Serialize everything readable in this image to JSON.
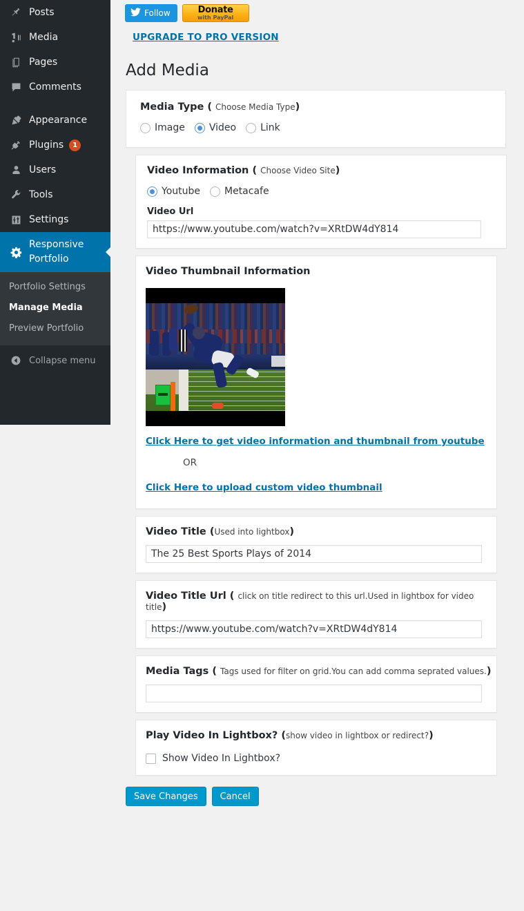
{
  "sidebar": {
    "items": [
      {
        "label": "Posts",
        "icon": "pin-icon",
        "badge": null
      },
      {
        "label": "Media",
        "icon": "media-icon",
        "badge": null
      },
      {
        "label": "Pages",
        "icon": "pages-icon",
        "badge": null
      },
      {
        "label": "Comments",
        "icon": "comments-icon",
        "badge": null
      },
      {
        "label": "Appearance",
        "icon": "appearance-brush-icon",
        "badge": null
      },
      {
        "label": "Plugins",
        "icon": "plugin-icon",
        "badge": "1"
      },
      {
        "label": "Users",
        "icon": "user-icon",
        "badge": null
      },
      {
        "label": "Tools",
        "icon": "wrench-icon",
        "badge": null
      },
      {
        "label": "Settings",
        "icon": "settings-sliders-icon",
        "badge": null
      },
      {
        "label": "Responsive Portfolio",
        "icon": "gear-icon",
        "badge": null
      }
    ],
    "submenu": [
      {
        "label": "Portfolio Settings",
        "current": false
      },
      {
        "label": "Manage Media",
        "current": true
      },
      {
        "label": "Preview Portfolio",
        "current": false
      }
    ],
    "collapse_label": "Collapse menu",
    "active_color": "#0073aa",
    "bg_color": "#23282d",
    "submenu_bg_color": "#32373c",
    "badge_color": "#d54e21"
  },
  "topbar": {
    "twitter_follow_label": "Follow",
    "paypal_main": "Donate",
    "paypal_sub": "with PayPal",
    "upgrade_label": "UPGRADE TO PRO VERSION",
    "link_color": "#0073aa"
  },
  "page": {
    "title": "Add Media"
  },
  "media_type": {
    "heading": "Media Type",
    "hint": "Choose Media Type",
    "options": [
      {
        "label": "Image",
        "selected": false
      },
      {
        "label": "Video",
        "selected": true
      },
      {
        "label": "Link",
        "selected": false
      }
    ]
  },
  "video_info": {
    "heading": "Video Information",
    "hint": "Choose Video Site",
    "options": [
      {
        "label": "Youtube",
        "selected": true
      },
      {
        "label": "Metacafe",
        "selected": false
      }
    ],
    "url_label": "Video Url",
    "url_value": "https://www.youtube.com/watch?v=XRtDW4dY814",
    "url_placeholder": ""
  },
  "thumbnail": {
    "heading": "Video Thumbnail Information",
    "image_alt": "football-catch-thumbnail",
    "fetch_link": "Click Here to get video information and thumbnail from youtube ",
    "or_text": "OR",
    "upload_link": "Click Here to upload custom video thumbnail"
  },
  "video_title": {
    "heading": "Video Title",
    "hint": "Used into lightbox",
    "value": "The 25 Best Sports Plays of 2014",
    "placeholder": ""
  },
  "video_title_url": {
    "heading": "Video Title Url",
    "hint": "click on title redirect to this url.Used in lightbox for video title",
    "value": "https://www.youtube.com/watch?v=XRtDW4dY814",
    "placeholder": ""
  },
  "media_tags": {
    "heading": "Media Tags",
    "hint": "Tags used for filter on grid.You can add comma seprated values.",
    "value": "",
    "placeholder": ""
  },
  "lightbox": {
    "heading": "Play Video In Lightbox?",
    "hint": "show video in lightbox or redirect?",
    "checkbox_label": "Show Video In Lightbox?",
    "checked": false
  },
  "actions": {
    "save_label": "Save Changes",
    "cancel_label": "Cancel",
    "button_color": "#0099cc"
  }
}
